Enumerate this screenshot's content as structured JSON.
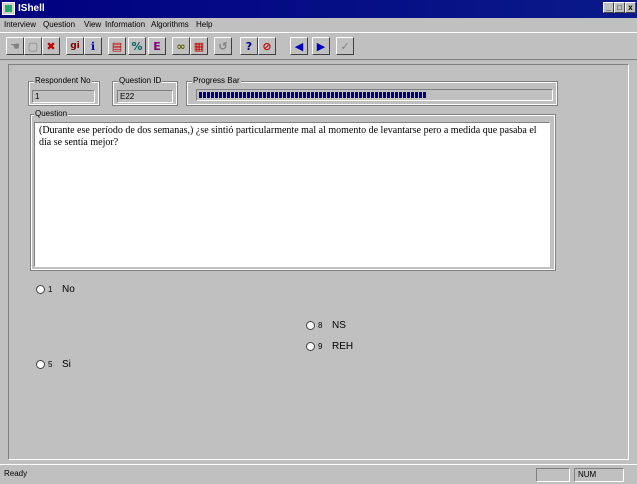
{
  "window": {
    "title": "IShell"
  },
  "menu": [
    "Interview",
    "Question",
    "View",
    "Information",
    "Algorithms",
    "Help"
  ],
  "toolbar": {
    "buttons": [
      {
        "name": "back-pointer-icon",
        "glyph": "☚"
      },
      {
        "name": "blank-icon",
        "glyph": "▢"
      },
      {
        "name": "delete-icon",
        "glyph": "✖"
      },
      {
        "name": "gi-icon",
        "glyph": "gi"
      },
      {
        "name": "info-icon",
        "glyph": "ℹ"
      },
      {
        "name": "book-icon",
        "glyph": "▤"
      },
      {
        "name": "percent-icon",
        "glyph": "%"
      },
      {
        "name": "edit-icon",
        "glyph": "E"
      },
      {
        "name": "chart-icon",
        "glyph": "∞"
      },
      {
        "name": "colors-icon",
        "glyph": "▦"
      },
      {
        "name": "refresh-icon",
        "glyph": "↺"
      },
      {
        "name": "help-icon",
        "glyph": "?"
      },
      {
        "name": "stop-icon",
        "glyph": "⊘"
      },
      {
        "name": "prev-icon",
        "glyph": "◀"
      },
      {
        "name": "next-icon",
        "glyph": "▶"
      },
      {
        "name": "check-icon",
        "glyph": "✓"
      }
    ]
  },
  "respondent": {
    "label": "Respondent No",
    "value": "1"
  },
  "question_id": {
    "label": "Question ID",
    "value": "E22"
  },
  "progress": {
    "label": "Progress Bar",
    "fraction": 0.65
  },
  "question": {
    "label": "Question",
    "text": "(Durante ese período de dos semanas,) ¿se sintió particularmente mal al momento de levantarse pero a medida que pasaba el día se sentía mejor?"
  },
  "answers": [
    {
      "code": "1",
      "label": "No"
    },
    {
      "code": "5",
      "label": "Si"
    },
    {
      "code": "8",
      "label": "NS"
    },
    {
      "code": "9",
      "label": "REH"
    }
  ],
  "status": {
    "text": "Ready",
    "num": "NUM"
  },
  "window_buttons": [
    "_",
    "□",
    "x"
  ]
}
